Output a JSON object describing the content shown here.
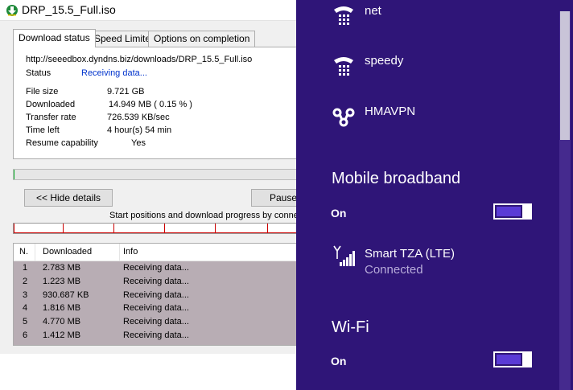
{
  "download_window": {
    "title": "DRP_15.5_Full.iso",
    "tabs": [
      "Download status",
      "Speed Limiter",
      "Options on completion"
    ],
    "url": "http://seeedbox.dyndns.biz/downloads/DRP_15.5_Full.iso",
    "status_label": "Status",
    "status_value": "Receiving data...",
    "info": [
      {
        "label": "File size",
        "value": "9.721  GB"
      },
      {
        "label": "Downloaded",
        "value": "14.949  MB  ( 0.15 % )"
      },
      {
        "label": "Transfer rate",
        "value": "726.539  KB/sec"
      },
      {
        "label": "Time left",
        "value": "4 hour(s) 54 min"
      },
      {
        "label": "Resume capability",
        "value": "Yes"
      }
    ],
    "progress_percent": 0.15,
    "hide_details_label": "<< Hide details",
    "pause_label": "Pause",
    "sectors_caption": "Start positions and download progress by connections",
    "columns": [
      "N.",
      "Downloaded",
      "Info"
    ],
    "connections": [
      {
        "n": "1",
        "downloaded": "2.783  MB",
        "info": "Receiving data..."
      },
      {
        "n": "2",
        "downloaded": "1.223  MB",
        "info": "Receiving data..."
      },
      {
        "n": "3",
        "downloaded": "930.687  KB",
        "info": "Receiving data..."
      },
      {
        "n": "4",
        "downloaded": "1.816  MB",
        "info": "Receiving data..."
      },
      {
        "n": "5",
        "downloaded": "4.770  MB",
        "info": "Receiving data..."
      },
      {
        "n": "6",
        "downloaded": "1.412  MB",
        "info": "Receiving data..."
      }
    ]
  },
  "network_panel": {
    "colors": {
      "background": "#2f1578",
      "toggle_fill": "#5a3bd6",
      "subtext": "#b7abd9"
    },
    "networks": [
      {
        "name": "net",
        "icon": "dialup-phone-icon"
      },
      {
        "name": "speedy",
        "icon": "dialup-phone-icon"
      },
      {
        "name": "HMAVPN",
        "icon": "vpn-link-icon"
      }
    ],
    "mobile_broadband": {
      "title": "Mobile broadband",
      "toggle_label": "On",
      "connection_name": "Smart TZA (LTE)",
      "connection_status": "Connected",
      "icon": "cellular-signal-icon"
    },
    "wifi": {
      "title": "Wi-Fi",
      "toggle_label": "On"
    }
  }
}
